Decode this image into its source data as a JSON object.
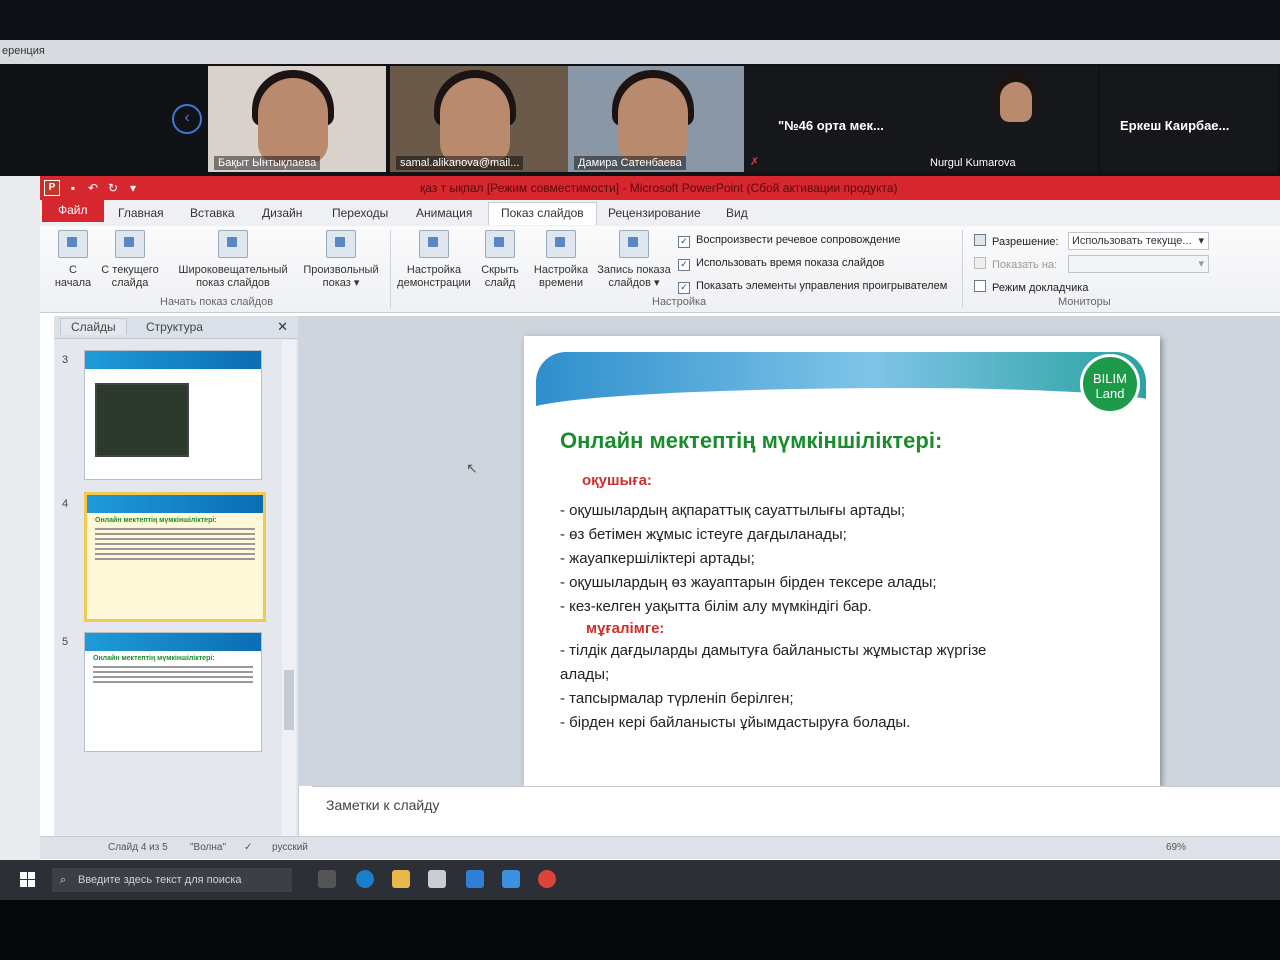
{
  "conference": {
    "strip_label": "еренция",
    "participants": [
      {
        "name": "Бақыт Ынтықлаева"
      },
      {
        "name": "samal.alikanova@mail..."
      },
      {
        "name": "Дамира Сатенбаева"
      },
      {
        "name": "\"№46 орта мек...",
        "muted": true
      },
      {
        "name": "Nurgul Kumarova",
        "muted": true
      },
      {
        "name": "Еркеш Каирбае..."
      }
    ]
  },
  "window": {
    "title": "қаз т ықпал [Режим совместимости] - Microsoft PowerPoint (Сбой активации продукта)"
  },
  "tabs": [
    "Файл",
    "Главная",
    "Вставка",
    "Дизайн",
    "Переходы",
    "Анимация",
    "Показ слайдов",
    "Рецензирование",
    "Вид"
  ],
  "ribbon": {
    "start_group": {
      "label": "Начать показ слайдов",
      "buttons": [
        "С начала",
        "С текущего слайда",
        "Широковещательный показ слайдов",
        "Произвольный показ"
      ]
    },
    "setup_group": {
      "label": "Настройка",
      "buttons": [
        "Настройка демонстрации",
        "Скрыть слайд",
        "Настройка времени",
        "Запись показа слайдов"
      ],
      "checks": [
        {
          "label": "Воспроизвести речевое сопровождение",
          "checked": true
        },
        {
          "label": "Использовать время показа слайдов",
          "checked": true
        },
        {
          "label": "Показать элементы управления проигрывателем",
          "checked": true
        }
      ]
    },
    "monitors_group": {
      "label": "Мониторы",
      "resolution_label": "Разрешение:",
      "resolution_value": "Использовать текуще...",
      "show_on_label": "Показать на:",
      "presenter_label": "Режим докладчика",
      "presenter_checked": false
    }
  },
  "slides_pane": {
    "tab_slides": "Слайды",
    "tab_outline": "Структура",
    "thumbnails": [
      {
        "number": "3"
      },
      {
        "number": "4",
        "selected": true
      },
      {
        "number": "5"
      }
    ]
  },
  "slide": {
    "logo": "BILIM Land",
    "title": "Онлайн мектептің мүмкіншіліктері:",
    "student_header": "оқушыға:",
    "student_items": [
      "-     оқушылардың ақпараттық сауаттылығы артады;",
      "-     өз бетімен жұмыс істеуге дағдыланады;",
      "-     жауапкершіліктері  артады;",
      "-     оқушылардың өз жауаптарын бірден тексере алады;",
      "-      кез-келген уақытта білім алу мүмкіндігі бар."
    ],
    "teacher_header": "мұғалімге:",
    "teacher_items": [
      "-    тілдік  дағдыларды  дамытуға  байланысты  жұмыстар  жүргізе",
      "алады;",
      "-     тапсырмалар   түрленіп  берілген;",
      "-      бірден кері байланысты ұйымдастыруға болады."
    ]
  },
  "notes_placeholder": "Заметки к слайду",
  "status": {
    "slide_info": "Слайд 4 из 5",
    "theme": "\"Волна\"",
    "language": "русский",
    "zoom": "69%"
  },
  "taskbar": {
    "search_placeholder": "Введите здесь текст для поиска"
  }
}
